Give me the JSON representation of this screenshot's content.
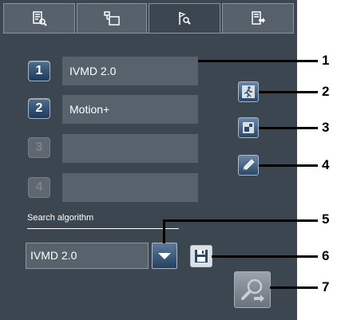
{
  "tabs": [
    {
      "icon": "list-magnifier-icon",
      "active": false
    },
    {
      "icon": "folder-tree-icon",
      "active": false
    },
    {
      "icon": "flag-magnifier-icon",
      "active": true
    },
    {
      "icon": "export-list-icon",
      "active": false
    }
  ],
  "slots": [
    {
      "number": "1",
      "value": "IVMD 2.0",
      "enabled": true
    },
    {
      "number": "2",
      "value": "Motion+",
      "enabled": true
    },
    {
      "number": "3",
      "value": "",
      "enabled": false
    },
    {
      "number": "4",
      "value": "",
      "enabled": false
    }
  ],
  "side_buttons": [
    {
      "icon": "motion-runner-icon"
    },
    {
      "icon": "area-squares-icon"
    },
    {
      "icon": "edit-pencil-icon"
    }
  ],
  "search": {
    "label": "Search algorithm",
    "selected": "IVMD 2.0",
    "save_icon": "save-icon",
    "search_icon": "search-magnifier-icon"
  },
  "callouts": [
    "1",
    "2",
    "3",
    "4",
    "5",
    "6",
    "7"
  ],
  "colors": {
    "panel_bg": "#3c4650",
    "field_bg": "#57626c",
    "button_blue": "#2b4868",
    "disabled": "#5f6870"
  }
}
